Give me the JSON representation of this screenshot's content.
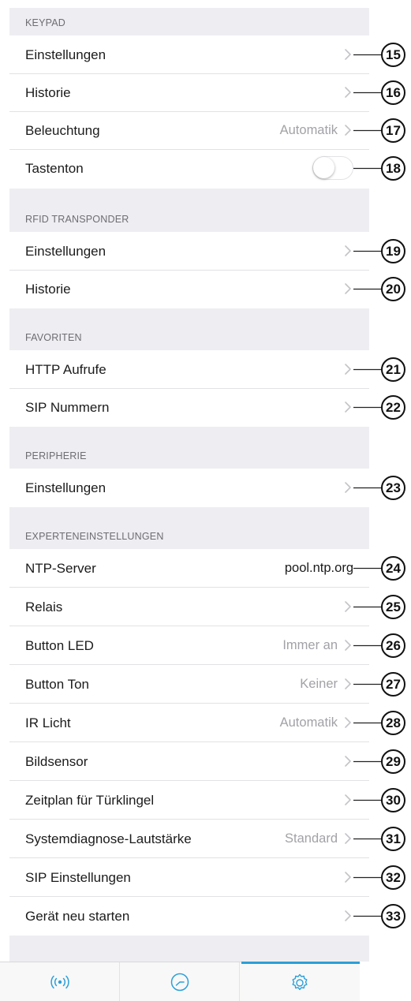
{
  "sections": [
    {
      "title": "KEYPAD",
      "rows": [
        {
          "label": "Einstellungen",
          "value": "",
          "callout": "15"
        },
        {
          "label": "Historie",
          "value": "",
          "callout": "16"
        },
        {
          "label": "Beleuchtung",
          "value": "Automatik",
          "callout": "17"
        },
        {
          "label": "Tastenton",
          "toggle": false,
          "callout": "18"
        }
      ]
    },
    {
      "title": "RFID TRANSPONDER",
      "rows": [
        {
          "label": "Einstellungen",
          "value": "",
          "callout": "19"
        },
        {
          "label": "Historie",
          "value": "",
          "callout": "20"
        }
      ]
    },
    {
      "title": "FAVORITEN",
      "rows": [
        {
          "label": "HTTP Aufrufe",
          "value": "",
          "callout": "21"
        },
        {
          "label": "SIP Nummern",
          "value": "",
          "callout": "22"
        }
      ]
    },
    {
      "title": "PERIPHERIE",
      "rows": [
        {
          "label": "Einstellungen",
          "value": "",
          "callout": "23"
        }
      ]
    },
    {
      "title": "EXPERTENEINSTELLUNGEN",
      "rows": [
        {
          "label": "NTP-Server",
          "value": "pool.ntp.org",
          "callout": "24"
        },
        {
          "label": "Relais",
          "value": "",
          "callout": "25"
        },
        {
          "label": "Button LED",
          "value": "Immer an",
          "callout": "26"
        },
        {
          "label": "Button Ton",
          "value": "Keiner",
          "callout": "27"
        },
        {
          "label": "IR Licht",
          "value": "Automatik",
          "callout": "28"
        },
        {
          "label": "Bildsensor",
          "value": "",
          "callout": "29"
        },
        {
          "label": "Zeitplan für Türklingel",
          "value": "",
          "callout": "30"
        },
        {
          "label": "Systemdiagnose-Lautstärke",
          "value": "Standard",
          "callout": "31"
        },
        {
          "label": "SIP Einstellungen",
          "value": "",
          "callout": "32"
        },
        {
          "label": "Gerät neu starten",
          "value": "",
          "callout": "33"
        }
      ]
    }
  ],
  "tabs": [
    {
      "icon": "broadcast-icon",
      "active": false
    },
    {
      "icon": "clock-icon",
      "active": false
    },
    {
      "icon": "gear-icon",
      "active": true
    }
  ],
  "colors": {
    "accent": "#2b9fd8",
    "section_bg": "#eeeef2",
    "secondary_text": "#a2a2a7"
  }
}
